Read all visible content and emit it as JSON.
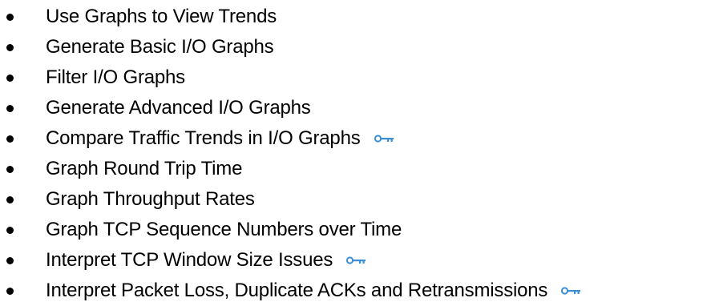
{
  "bullets": [
    {
      "text": "Use Graphs to View Trends",
      "key_icon": false
    },
    {
      "text": "Generate Basic I/O Graphs",
      "key_icon": false
    },
    {
      "text": "Filter I/O Graphs",
      "key_icon": false
    },
    {
      "text": "Generate Advanced I/O Graphs",
      "key_icon": false
    },
    {
      "text": "Compare Traffic Trends in I/O Graphs",
      "key_icon": true
    },
    {
      "text": "Graph Round Trip Time",
      "key_icon": false
    },
    {
      "text": "Graph Throughput Rates",
      "key_icon": false
    },
    {
      "text": "Graph TCP Sequence Numbers over Time",
      "key_icon": false
    },
    {
      "text": "Interpret TCP Window Size Issues",
      "key_icon": true
    },
    {
      "text": "Interpret Packet Loss, Duplicate ACKs and Retransmissions",
      "key_icon": true
    }
  ],
  "icons": {
    "key": "key-icon"
  },
  "colors": {
    "text": "#000000",
    "bullet": "#000000",
    "key_icon": "#3a8fd6",
    "background": "#ffffff"
  }
}
